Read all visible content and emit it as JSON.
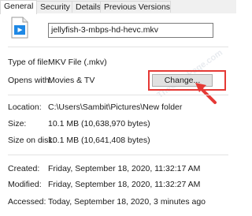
{
  "tabs": [
    {
      "label": "General",
      "active": true
    },
    {
      "label": "Security",
      "active": false
    },
    {
      "label": "Details",
      "active": false
    },
    {
      "label": "Previous Versions",
      "active": false
    }
  ],
  "file": {
    "icon": "video-file-icon",
    "name": "jellyfish-3-mbps-hd-hevc.mkv"
  },
  "properties": {
    "type_label": "Type of file:",
    "type_value": "MKV File (.mkv)",
    "opens_label": "Opens with:",
    "opens_value": "Movies & TV",
    "change_label": "Change...",
    "location_label": "Location:",
    "location_value": "C:\\Users\\Sambit\\Pictures\\New folder",
    "size_label": "Size:",
    "size_value": "10.1 MB (10,638,970 bytes)",
    "size_on_disk_label": "Size on disk:",
    "size_on_disk_value": "10.1 MB (10,641,408 bytes)",
    "created_label": "Created:",
    "created_value": "Friday, September 18, 2020, 11:32:17 AM",
    "modified_label": "Modified:",
    "modified_value": "Friday, September 18, 2020, 11:32:27 AM",
    "accessed_label": "Accessed:",
    "accessed_value": "Today, September 18, 2020, 3 minutes ago"
  },
  "watermark": "TheGeekPage.com",
  "colors": {
    "highlight": "#e53935",
    "tab_bar": "#f0f0f0",
    "button": "#e1e1e1"
  }
}
